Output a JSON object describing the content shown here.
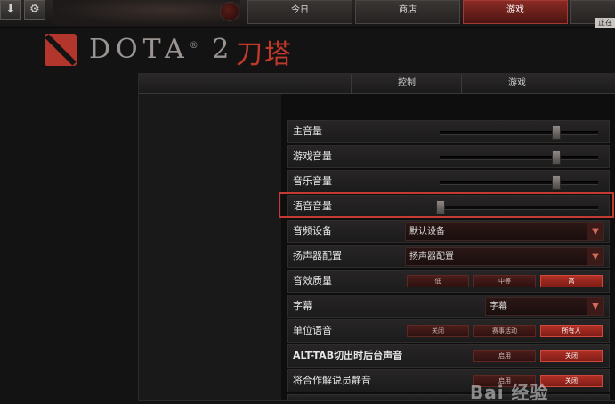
{
  "topbar": {
    "tabs": [
      {
        "label": "今日",
        "active": false
      },
      {
        "label": "商店",
        "active": false
      },
      {
        "label": "游戏",
        "active": true
      }
    ],
    "corner_label": "正在"
  },
  "logo": {
    "text": "DOTA",
    "reg": "®",
    "number": "2",
    "chinese": "刀塔"
  },
  "panel": {
    "tabs": [
      "控制",
      "游戏"
    ],
    "rows": [
      {
        "label": "主音量",
        "type": "slider",
        "value": 0.74
      },
      {
        "label": "游戏音量",
        "type": "slider",
        "value": 0.74
      },
      {
        "label": "音乐音量",
        "type": "slider",
        "value": 0.74
      },
      {
        "label": "语音音量",
        "type": "slider",
        "value": 0.0
      },
      {
        "label": "音频设备",
        "type": "dropdown",
        "value": "默认设备"
      },
      {
        "label": "扬声器配置",
        "type": "dropdown",
        "value": "扬声器配置"
      },
      {
        "label": "音效质量",
        "type": "options",
        "options": [
          "低",
          "中等",
          "高"
        ],
        "selected": 2
      },
      {
        "label": "字幕",
        "type": "dropdown",
        "value": "字幕"
      },
      {
        "label": "单位语音",
        "type": "options",
        "options": [
          "关闭",
          "赛事活动",
          "所有人"
        ],
        "selected": 2
      },
      {
        "label": "ALT-TAB切出时后台声音",
        "type": "options",
        "options": [
          "启用",
          "关闭"
        ],
        "selected": 1
      },
      {
        "label": "将合作解说员静音",
        "type": "options",
        "options": [
          "启用",
          "关闭"
        ],
        "selected": 1
      },
      {
        "label": "",
        "type": "partial"
      }
    ]
  },
  "watermark": "Bai 经验",
  "colors": {
    "accent": "#b2362b",
    "panel_bg": "#0e0e0e",
    "highlight": "#c33b32"
  }
}
